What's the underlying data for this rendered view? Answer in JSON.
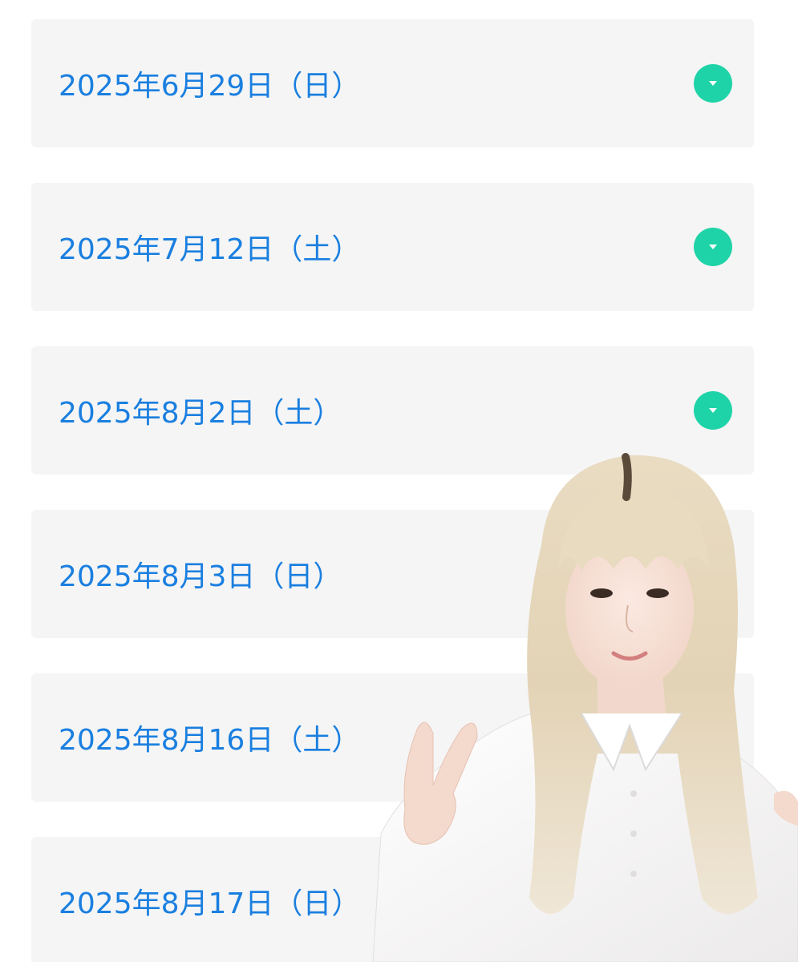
{
  "accordion": {
    "items": [
      {
        "label": "2025年6月29日（日）"
      },
      {
        "label": "2025年7月12日（土）"
      },
      {
        "label": "2025年8月2日（土）"
      },
      {
        "label": "2025年8月3日（日）"
      },
      {
        "label": "2025年8月16日（土）"
      },
      {
        "label": "2025年8月17日（日）"
      }
    ],
    "toggle_icon": "chevron-down-icon"
  },
  "colors": {
    "label_blue": "#1a7fe0",
    "toggle_green": "#1fd3a8",
    "card_bg": "#f5f5f5"
  },
  "overlay": {
    "subject": "person-photo"
  }
}
